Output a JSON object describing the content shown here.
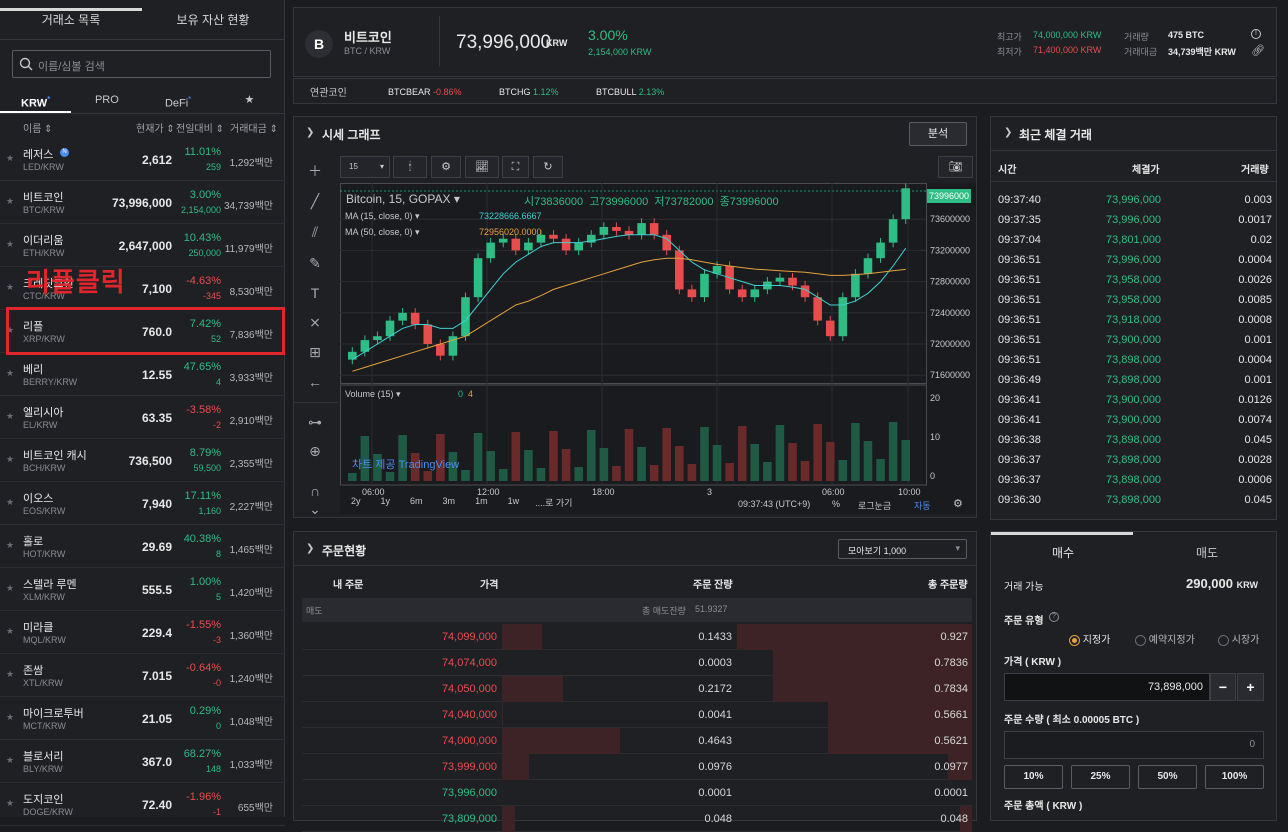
{
  "left": {
    "tabs": [
      "거래소 목록",
      "보유 자산 현황"
    ],
    "search_placeholder": "이름/심볼 검색",
    "market_tabs": [
      {
        "label": "KRW",
        "mark": "*"
      },
      {
        "label": "PRO",
        "mark": ""
      },
      {
        "label": "DeFi",
        "mark": "*"
      },
      {
        "label": "★",
        "mark": ""
      }
    ],
    "columns": {
      "name": "이름 ⇕",
      "price": "현재가 ⇕",
      "change": "전일대비 ⇕",
      "volume": "거래대금 ⇕"
    },
    "coins": [
      {
        "name": "레저스",
        "symbol": "LED/KRW",
        "price": "2,612",
        "change": "11.01%",
        "change_abs": "259",
        "volume": "1,292백만",
        "dir": "up",
        "badge": "N"
      },
      {
        "name": "비트코인",
        "symbol": "BTC/KRW",
        "price": "73,996,000",
        "change": "3.00%",
        "change_abs": "2,154,000",
        "volume": "34,739백만",
        "dir": "up"
      },
      {
        "name": "이더리움",
        "symbol": "ETH/KRW",
        "price": "2,647,000",
        "change": "10.43%",
        "change_abs": "250,000",
        "volume": "11,979백만",
        "dir": "up"
      },
      {
        "name": "크레딧코인",
        "symbol": "CTC/KRW",
        "price": "7,100",
        "change": "-4.63%",
        "change_abs": "-345",
        "volume": "8,530백만",
        "dir": "dn"
      },
      {
        "name": "리플",
        "symbol": "XRP/KRW",
        "price": "760.0",
        "change": "7.42%",
        "change_abs": "52",
        "volume": "7,836백만",
        "dir": "up"
      },
      {
        "name": "베리",
        "symbol": "BERRY/KRW",
        "price": "12.55",
        "change": "47.65%",
        "change_abs": "4",
        "volume": "3,933백만",
        "dir": "up"
      },
      {
        "name": "엘리시아",
        "symbol": "EL/KRW",
        "price": "63.35",
        "change": "-3.58%",
        "change_abs": "-2",
        "volume": "2,910백만",
        "dir": "dn"
      },
      {
        "name": "비트코인 캐시",
        "symbol": "BCH/KRW",
        "price": "736,500",
        "change": "8.79%",
        "change_abs": "59,500",
        "volume": "2,355백만",
        "dir": "up"
      },
      {
        "name": "이오스",
        "symbol": "EOS/KRW",
        "price": "7,940",
        "change": "17.11%",
        "change_abs": "1,160",
        "volume": "2,227백만",
        "dir": "up"
      },
      {
        "name": "홀로",
        "symbol": "HOT/KRW",
        "price": "29.69",
        "change": "40.38%",
        "change_abs": "8",
        "volume": "1,465백만",
        "dir": "up"
      },
      {
        "name": "스텔라 루멘",
        "symbol": "XLM/KRW",
        "price": "555.5",
        "change": "1.00%",
        "change_abs": "5",
        "volume": "1,420백만",
        "dir": "up"
      },
      {
        "name": "미라클",
        "symbol": "MQL/KRW",
        "price": "229.4",
        "change": "-1.55%",
        "change_abs": "-3",
        "volume": "1,360백만",
        "dir": "dn"
      },
      {
        "name": "존쌈",
        "symbol": "XTL/KRW",
        "price": "7.015",
        "change": "-0.64%",
        "change_abs": "-0",
        "volume": "1,240백만",
        "dir": "dn"
      },
      {
        "name": "마이크로투버",
        "symbol": "MCT/KRW",
        "price": "21.05",
        "change": "0.29%",
        "change_abs": "0",
        "volume": "1,048백만",
        "dir": "up"
      },
      {
        "name": "블로서리",
        "symbol": "BLY/KRW",
        "price": "367.0",
        "change": "68.27%",
        "change_abs": "148",
        "volume": "1,033백만",
        "dir": "up"
      },
      {
        "name": "도지코인",
        "symbol": "DOGE/KRW",
        "price": "72.40",
        "change": "-1.96%",
        "change_abs": "-1",
        "volume": "655백만",
        "dir": "dn"
      }
    ],
    "annotation": "리플클릭"
  },
  "header": {
    "coin_icon": "B",
    "name": "비트코인",
    "pair": "BTC / KRW",
    "price": "73,996,000",
    "price_unit": "KRW",
    "change_pct": "3.00%",
    "change_abs": "2,154,000 KRW",
    "high_label": "최고가",
    "high": "74,000,000 KRW",
    "low_label": "최저가",
    "low": "71,400,000 KRW",
    "vol_label": "거래량",
    "vol": "475 BTC",
    "amt_label": "거래대금",
    "amt": "34,739백만 KRW",
    "related_label": "연관코인",
    "related": [
      {
        "sym": "BTCBEAR",
        "chg": "-0.86%",
        "dir": "dn"
      },
      {
        "sym": "BTCHG",
        "chg": "1.12%",
        "dir": "up"
      },
      {
        "sym": "BTCBULL",
        "chg": "2.13%",
        "dir": "up"
      }
    ]
  },
  "chart": {
    "title": "시세 그래프",
    "analysis": "분석",
    "interval": "15",
    "legend_title": "Bitcoin, 15, GOPAX",
    "ohlc": {
      "o": "시73836000",
      "h": "고73996000",
      "l": "저73782000",
      "c": "종73996000"
    },
    "ma1_label": "MA (15, close, 0)",
    "ma1_val": "73228666.6667",
    "ma2_label": "MA (50, close, 0)",
    "ma2_val": "72956020.0000",
    "price_tag": "73996000",
    "y_ticks": [
      "73600000",
      "73200000",
      "72800000",
      "72400000",
      "72000000",
      "71600000"
    ],
    "volume_label": "Volume (15)",
    "volume_vals": [
      "0",
      "4"
    ],
    "vol_ticks": [
      "20",
      "10",
      "0"
    ],
    "x_ticks": [
      "06:00",
      "12:00",
      "18:00",
      "3",
      "06:00",
      "10:00"
    ],
    "watermark": "차트 제공 TradingView",
    "ranges": [
      "2y",
      "1y",
      "6m",
      "3m",
      "1m",
      "1w",
      "....로 가기"
    ],
    "time": "09:37:43 (UTC+9)",
    "footer_opts": [
      "%",
      "로그눈금",
      "자동"
    ]
  },
  "chart_data": {
    "type": "line",
    "title": "Bitcoin, 15, GOPAX",
    "series": [
      {
        "name": "close",
        "values": [
          71900000,
          72050000,
          72100000,
          72300000,
          72400000,
          72250000,
          72000000,
          71850000,
          72100000,
          72600000,
          73100000,
          73300000,
          73350000,
          73200000,
          73300000,
          73400000,
          73350000,
          73200000,
          73300000,
          73400000,
          73500000,
          73450000,
          73400000,
          73550000,
          73400000,
          73200000,
          72700000,
          72600000,
          72900000,
          73000000,
          72700000,
          72600000,
          72700000,
          72800000,
          72850000,
          72750000,
          72600000,
          72300000,
          72100000,
          72600000,
          72900000,
          73100000,
          73300000,
          73600000,
          73996000
        ]
      },
      {
        "name": "MA (15, close, 0)",
        "values": [
          71800000,
          71900000,
          72000000,
          72100000,
          72200000,
          72250000,
          72250000,
          72200000,
          72200000,
          72300000,
          72500000,
          72700000,
          72900000,
          73050000,
          73150000,
          73250000,
          73300000,
          73300000,
          73300000,
          73320000,
          73350000,
          73380000,
          73400000,
          73400000,
          73400000,
          73350000,
          73200000,
          73050000,
          72950000,
          72900000,
          72850000,
          72800000,
          72750000,
          72750000,
          72750000,
          72730000,
          72700000,
          72600000,
          72500000,
          72500000,
          72550000,
          72650000,
          72800000,
          73000000,
          73228666
        ]
      },
      {
        "name": "MA (50, close, 0)",
        "values": [
          71650000,
          71700000,
          71750000,
          71800000,
          71850000,
          71900000,
          71950000,
          72000000,
          72050000,
          72100000,
          72200000,
          72300000,
          72400000,
          72500000,
          72550000,
          72620000,
          72700000,
          72750000,
          72800000,
          72850000,
          72900000,
          72950000,
          73000000,
          73050000,
          73080000,
          73100000,
          73100000,
          73080000,
          73050000,
          73020000,
          73000000,
          72980000,
          72960000,
          72950000,
          72940000,
          72930000,
          72920000,
          72900000,
          72880000,
          72880000,
          72890000,
          72900000,
          72920000,
          72940000,
          72956020
        ]
      }
    ],
    "ylim": [
      71500000,
      74000000
    ]
  },
  "trades": {
    "title": "최근 체결 거래",
    "cols": [
      "시간",
      "체결가",
      "거래량"
    ],
    "rows": [
      [
        "09:37:40",
        "73,996,000",
        "0.003",
        "up"
      ],
      [
        "09:37:35",
        "73,996,000",
        "0.0017",
        "up"
      ],
      [
        "09:37:04",
        "73,801,000",
        "0.02",
        "up"
      ],
      [
        "09:36:51",
        "73,996,000",
        "0.0004",
        "up"
      ],
      [
        "09:36:51",
        "73,958,000",
        "0.0026",
        "up"
      ],
      [
        "09:36:51",
        "73,958,000",
        "0.0085",
        "up"
      ],
      [
        "09:36:51",
        "73,918,000",
        "0.0008",
        "up"
      ],
      [
        "09:36:51",
        "73,900,000",
        "0.001",
        "up"
      ],
      [
        "09:36:51",
        "73,898,000",
        "0.0004",
        "up"
      ],
      [
        "09:36:49",
        "73,898,000",
        "0.001",
        "up"
      ],
      [
        "09:36:41",
        "73,900,000",
        "0.0126",
        "up"
      ],
      [
        "09:36:41",
        "73,900,000",
        "0.0074",
        "up"
      ],
      [
        "09:36:38",
        "73,898,000",
        "0.045",
        "up"
      ],
      [
        "09:36:37",
        "73,898,000",
        "0.0028",
        "up"
      ],
      [
        "09:36:37",
        "73,898,000",
        "0.0006",
        "up"
      ],
      [
        "09:36:30",
        "73,898,000",
        "0.045",
        "up"
      ]
    ]
  },
  "orderbook": {
    "title": "주문현황",
    "group": "모아보기 1,000",
    "cols": [
      "내 주문",
      "가격",
      "주문 잔량",
      "총 주문량"
    ],
    "sell_label": "매도",
    "sell_total_label": "총 매도잔량",
    "sell_total": "51.9327",
    "rows": [
      {
        "p": "74,099,000",
        "q": "0.1433",
        "t": "0.927",
        "b1": 0.34,
        "b2": 0.98,
        "dir": "dn"
      },
      {
        "p": "74,074,000",
        "q": "0.0003",
        "t": "0.7836",
        "b1": 0.0,
        "b2": 0.83,
        "dir": "dn"
      },
      {
        "p": "74,050,000",
        "q": "0.2172",
        "t": "0.7834",
        "b1": 0.52,
        "b2": 0.83,
        "dir": "dn"
      },
      {
        "p": "74,040,000",
        "q": "0.0041",
        "t": "0.5661",
        "b1": 0.01,
        "b2": 0.6,
        "dir": "dn"
      },
      {
        "p": "74,000,000",
        "q": "0.4643",
        "t": "0.5621",
        "b1": 1.0,
        "b2": 0.6,
        "dir": "dn"
      },
      {
        "p": "73,999,000",
        "q": "0.0976",
        "t": "0.0977",
        "b1": 0.23,
        "b2": 0.1,
        "dir": "dn"
      },
      {
        "p": "73,996,000",
        "q": "0.0001",
        "t": "0.0001",
        "b1": 0.0,
        "b2": 0.0,
        "dir": "up"
      },
      {
        "p": "73,809,000",
        "q": "0.048",
        "t": "0.048",
        "b1": 0.11,
        "b2": 0.05,
        "dir": "up"
      }
    ]
  },
  "order": {
    "tabs": [
      "매수",
      "매도"
    ],
    "avail_label": "거래 가능",
    "avail": "290,000",
    "avail_unit": "KRW",
    "type_label": "주문 유형",
    "types": [
      "지정가",
      "예약지정가",
      "시장가"
    ],
    "price_label": "가격 ( KRW )",
    "price": "73,898,000",
    "qty_label": "주문 수량 ( 최소 0.00005 BTC )",
    "qty_placeholder": "0",
    "pcts": [
      "10%",
      "25%",
      "50%",
      "100%"
    ],
    "total_label": "주문 총액 ( KRW )"
  }
}
